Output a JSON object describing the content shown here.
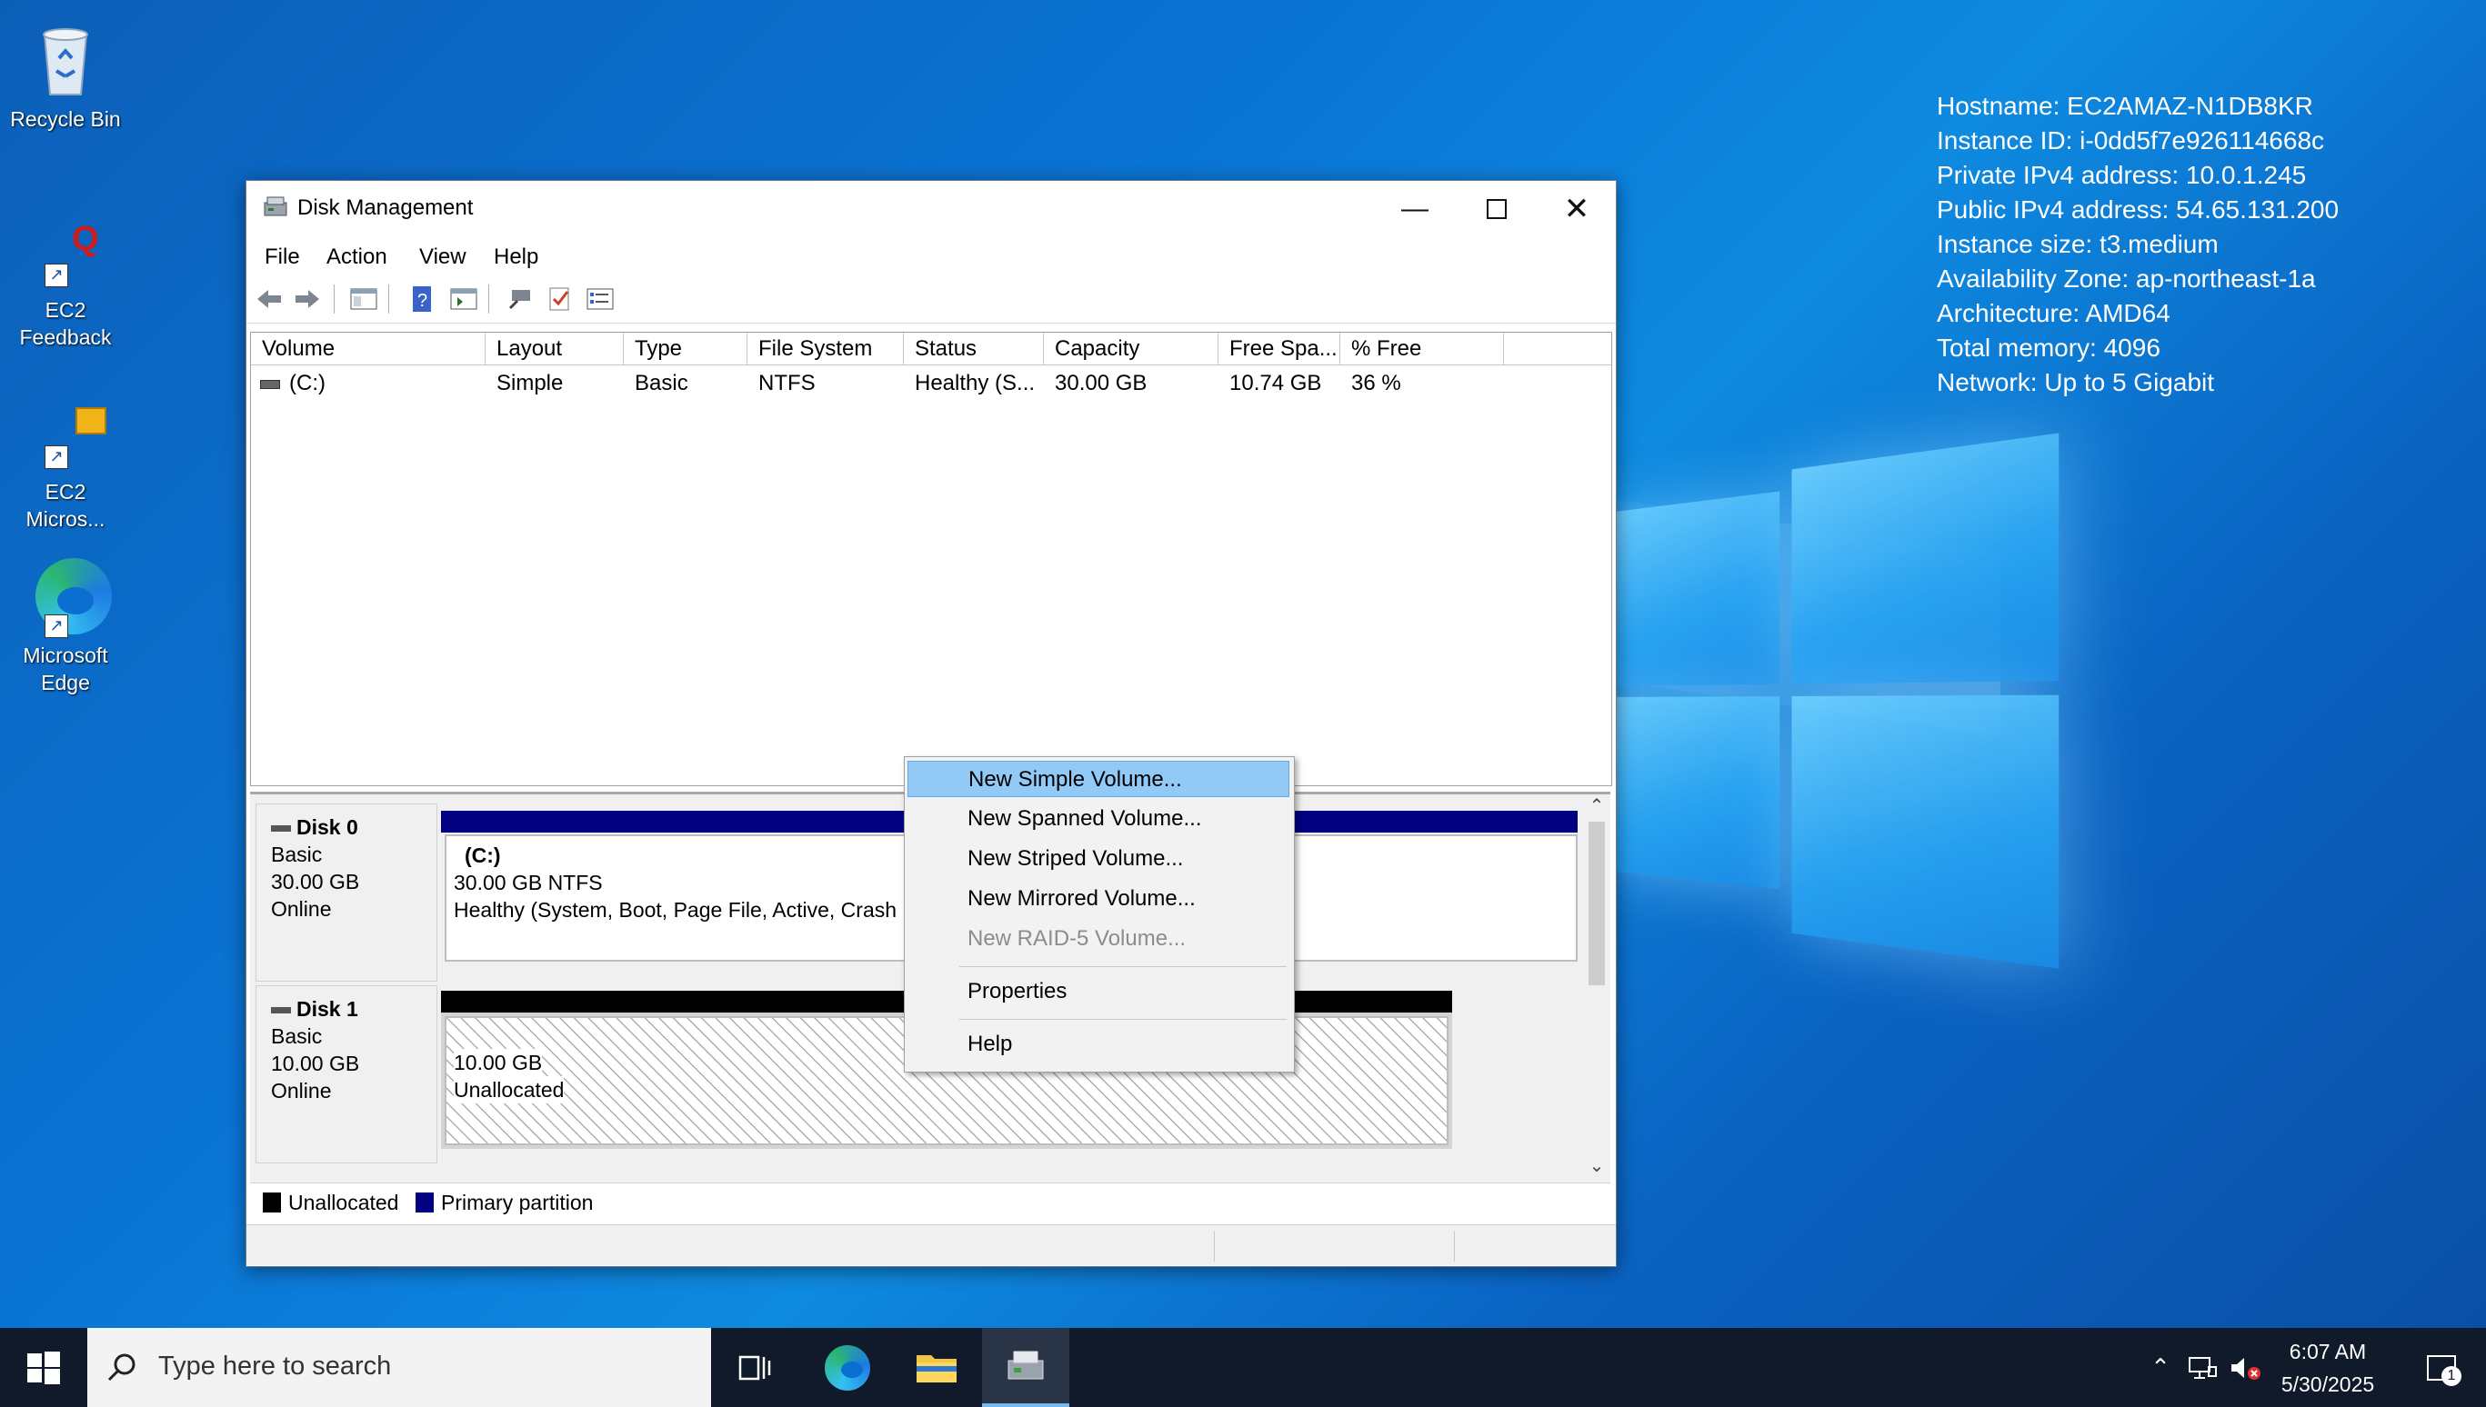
{
  "desktop": {
    "icons": [
      {
        "label": "Recycle Bin"
      },
      {
        "label": "EC2 Feedback"
      },
      {
        "label": "EC2 Micros..."
      },
      {
        "label": "Microsoft Edge"
      }
    ],
    "sysinfo": [
      "Hostname: EC2AMAZ-N1DB8KR",
      "Instance ID: i-0dd5f7e926114668c",
      "Private IPv4 address: 10.0.1.245",
      "Public IPv4 address: 54.65.131.200",
      "Instance size: t3.medium",
      "Availability Zone: ap-northeast-1a",
      "Architecture: AMD64",
      "Total memory: 4096",
      "Network: Up to 5 Gigabit"
    ]
  },
  "window": {
    "title": "Disk Management",
    "menu": [
      "File",
      "Action",
      "View",
      "Help"
    ],
    "columns": [
      "Volume",
      "Layout",
      "Type",
      "File System",
      "Status",
      "Capacity",
      "Free Spa...",
      "% Free"
    ],
    "rows": [
      [
        "(C:)",
        "Simple",
        "Basic",
        "NTFS",
        "Healthy (S...",
        "30.00 GB",
        "10.74 GB",
        "36 %"
      ]
    ],
    "disks": [
      {
        "name": "Disk 0",
        "type": "Basic",
        "size": "30.00 GB",
        "status": "Online",
        "partition": {
          "name": "(C:)",
          "size": "30.00 GB NTFS",
          "status": "Healthy (System, Boot, Page File, Active, Crash"
        }
      },
      {
        "name": "Disk 1",
        "type": "Basic",
        "size": "10.00 GB",
        "status": "Online",
        "partition": {
          "size": "10.00 GB",
          "status": "Unallocated"
        }
      }
    ],
    "legend": [
      "Unallocated",
      "Primary partition"
    ],
    "colors": {
      "primary": "#000080",
      "unallocated": "#000000",
      "highlight": "#91c9f7"
    }
  },
  "context_menu": {
    "items": [
      "New Simple Volume...",
      "New Spanned Volume...",
      "New Striped Volume...",
      "New Mirrored Volume...",
      "New RAID-5 Volume...",
      "Properties",
      "Help"
    ]
  },
  "taskbar": {
    "search_placeholder": "Type here to search",
    "time": "6:07 AM",
    "date": "5/30/2025",
    "notification_count": "1"
  }
}
